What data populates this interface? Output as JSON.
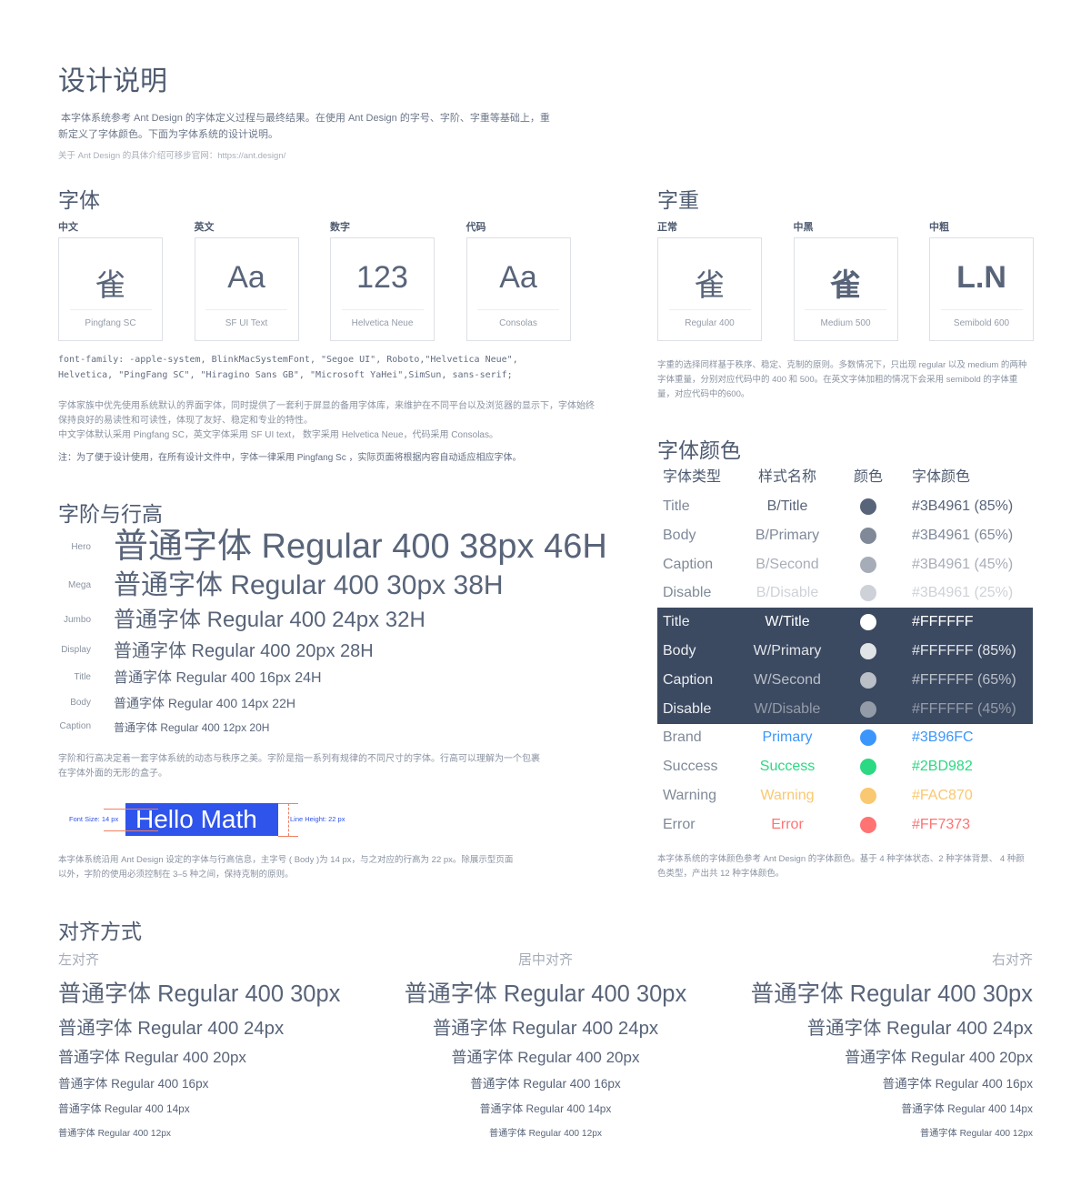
{
  "title": "设计说明",
  "intro": {
    "p1": "本字体系统参考 Ant Design 的字体定义过程与最终结果。在使用 Ant Design 的字号、字阶、字重等基础上，重",
    "p2": "新定义了字体颜色。下面为字体系统的设计说明。",
    "link": "关于 Ant Design 的具体介绍可移步官网：https://ant.design/"
  },
  "fonts": {
    "title": "字体",
    "cards": [
      {
        "label": "中文",
        "glyph": "雀",
        "name": "Pingfang SC"
      },
      {
        "label": "英文",
        "glyph": "Aa",
        "name": "SF UI Text"
      },
      {
        "label": "数字",
        "glyph": "123",
        "name": "Helvetica Neue"
      },
      {
        "label": "代码",
        "glyph": "Aa",
        "name": "Consolas"
      }
    ],
    "code1": "font-family: -apple-system, BlinkMacSystemFont, \"Segoe UI\", Roboto,\"Helvetica Neue\",",
    "code2": "Helvetica, \"PingFang SC\", \"Hiragino Sans GB\", \"Microsoft YaHei\",SimSun, sans-serif;",
    "d1": "字体家族中优先使用系统默认的界面字体，同时提供了一套利于屏显的备用字体库，来维护在不同平台以及浏览器的显示下，字体始终",
    "d2": "保持良好的易读性和可读性，体现了友好、稳定和专业的特性。",
    "d3": "中文字体默认采用 Pingfang SC，英文字体采用 SF UI text， 数字采用 Helvetica Neue，代码采用 Consolas。",
    "note": "注：为了便于设计使用，在所有设计文件中，字体一律采用 Pingfang Sc ，实际页面将根据内容自动适应相应字体。"
  },
  "weights": {
    "title": "字重",
    "cards": [
      {
        "label": "正常",
        "glyph": "雀",
        "name": "Regular 400"
      },
      {
        "label": "中黑",
        "glyph": "雀",
        "name": "Medium 500"
      },
      {
        "label": "中粗",
        "glyph": "L.N",
        "name": "Semibold 600"
      }
    ],
    "d1": "字重的选择同样基于秩序、稳定、克制的原则。多数情况下，只出现 regular 以及 medium 的两种",
    "d2": "字体重量，分别对应代码中的 400 和 500。在英文字体加粗的情况下会采用 semibold 的字体重",
    "d3": "量，对应代码中的600。"
  },
  "scale": {
    "title": "字阶与行高",
    "rows": [
      {
        "label": "Hero",
        "text": "普通字体 Regular 400 38px 46H"
      },
      {
        "label": "Mega",
        "text": "普通字体 Regular 400 30px 38H"
      },
      {
        "label": "Jumbo",
        "text": "普通字体 Regular 400 24px 32H"
      },
      {
        "label": "Display",
        "text": "普通字体 Regular 400 20px 28H"
      },
      {
        "label": "Title",
        "text": "普通字体 Regular 400 16px 24H"
      },
      {
        "label": "Body",
        "text": "普通字体 Regular 400 14px 22H"
      },
      {
        "label": "Caption",
        "text": "普通字体 Regular 400 12px 20H"
      }
    ],
    "d1": "字阶和行高决定着一套字体系统的动态与秩序之美。字阶是指一系列有规律的不同尺寸的字体。行高可以理解为一个包裹",
    "d2": "在字体外面的无形的盒子。",
    "demo": {
      "font_size": "Font Size: 14 px",
      "text": "Hello Math",
      "line_height": "Line Height: 22 px",
      "color": "#2F54EB"
    },
    "d3": "本字体系统沿用 Ant Design 设定的字体与行高信息，主字号 ( Body )为 14 px，与之对应的行高为 22 px。除展示型页面",
    "d4": "以外，字阶的使用必须控制在 3–5 种之间，保持克制的原则。"
  },
  "colors": {
    "title": "字体颜色",
    "headers": [
      "字体类型",
      "样式名称",
      "颜色",
      "字体颜色"
    ],
    "rows": [
      {
        "type": "Title",
        "style": "B/Title",
        "color": "#3B4961 (85%)",
        "hex": "rgba(59,73,97,.85)",
        "dark": false
      },
      {
        "type": "Body",
        "style": "B/Primary",
        "color": "#3B4961 (65%)",
        "hex": "rgba(59,73,97,.65)",
        "dark": false
      },
      {
        "type": "Caption",
        "style": "B/Second",
        "color": "#3B4961 (45%)",
        "hex": "rgba(59,73,97,.45)",
        "dark": false
      },
      {
        "type": "Disable",
        "style": "B/Disable",
        "color": "#3B4961 (25%)",
        "hex": "rgba(59,73,97,.25)",
        "dark": false
      },
      {
        "type": "Title",
        "style": "W/Title",
        "color": "#FFFFFF",
        "hex": "#FFFFFF",
        "dark": true
      },
      {
        "type": "Body",
        "style": "W/Primary",
        "color": "#FFFFFF (85%)",
        "hex": "rgba(255,255,255,.85)",
        "dark": true
      },
      {
        "type": "Caption",
        "style": "W/Second",
        "color": "#FFFFFF (65%)",
        "hex": "rgba(255,255,255,.65)",
        "dark": true
      },
      {
        "type": "Disable",
        "style": "W/Disable",
        "color": "#FFFFFF (45%)",
        "hex": "rgba(255,255,255,.45)",
        "dark": true
      },
      {
        "type": "Brand",
        "style": "Primary",
        "color": "#3B96FC",
        "hex": "#3B96FC",
        "dark": false
      },
      {
        "type": "Success",
        "style": "Success",
        "color": "#2BD982",
        "hex": "#2BD982",
        "dark": false
      },
      {
        "type": "Warning",
        "style": "Warning",
        "color": "#FAC870",
        "hex": "#FAC870",
        "dark": false
      },
      {
        "type": "Error",
        "style": "Error",
        "color": "#FF7373",
        "hex": "#FF7373",
        "dark": false
      }
    ],
    "dark_bg": "#3B4961",
    "d1": "本字体系统的字体颜色参考 Ant Design 的字体颜色。基于 4 种字体状态、2 种字体背景、 4 种颜",
    "d2": "色类型，产出共 12 种字体颜色。"
  },
  "align": {
    "title": "对齐方式",
    "columns": [
      "左对齐",
      "居中对齐",
      "右对齐"
    ],
    "rows": [
      "普通字体 Regular 400 30px",
      "普通字体 Regular 400 24px",
      "普通字体 Regular 400 20px",
      "普通字体 Regular 400 16px",
      "普通字体 Regular 400 14px",
      "普通字体 Regular 400 12px"
    ]
  }
}
